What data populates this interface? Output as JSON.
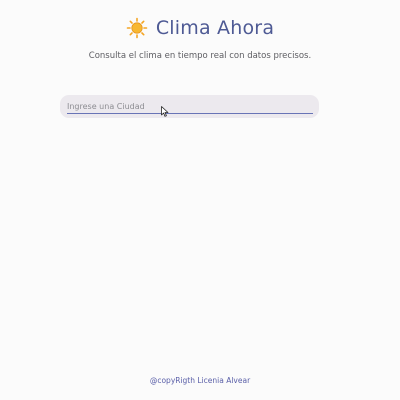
{
  "header": {
    "icon": "sun-icon",
    "title": "Clima Ahora"
  },
  "subtitle": "Consulta el clima en tiempo real con datos precisos.",
  "search": {
    "placeholder": "Ingrese una Ciudad",
    "value": ""
  },
  "footer": {
    "text": "@copyRigth Licenia Alvear"
  },
  "colors": {
    "title": "#4e5a94",
    "accent": "#6874b6",
    "input_bg": "#ece9ee",
    "sun": "#f4a523"
  }
}
